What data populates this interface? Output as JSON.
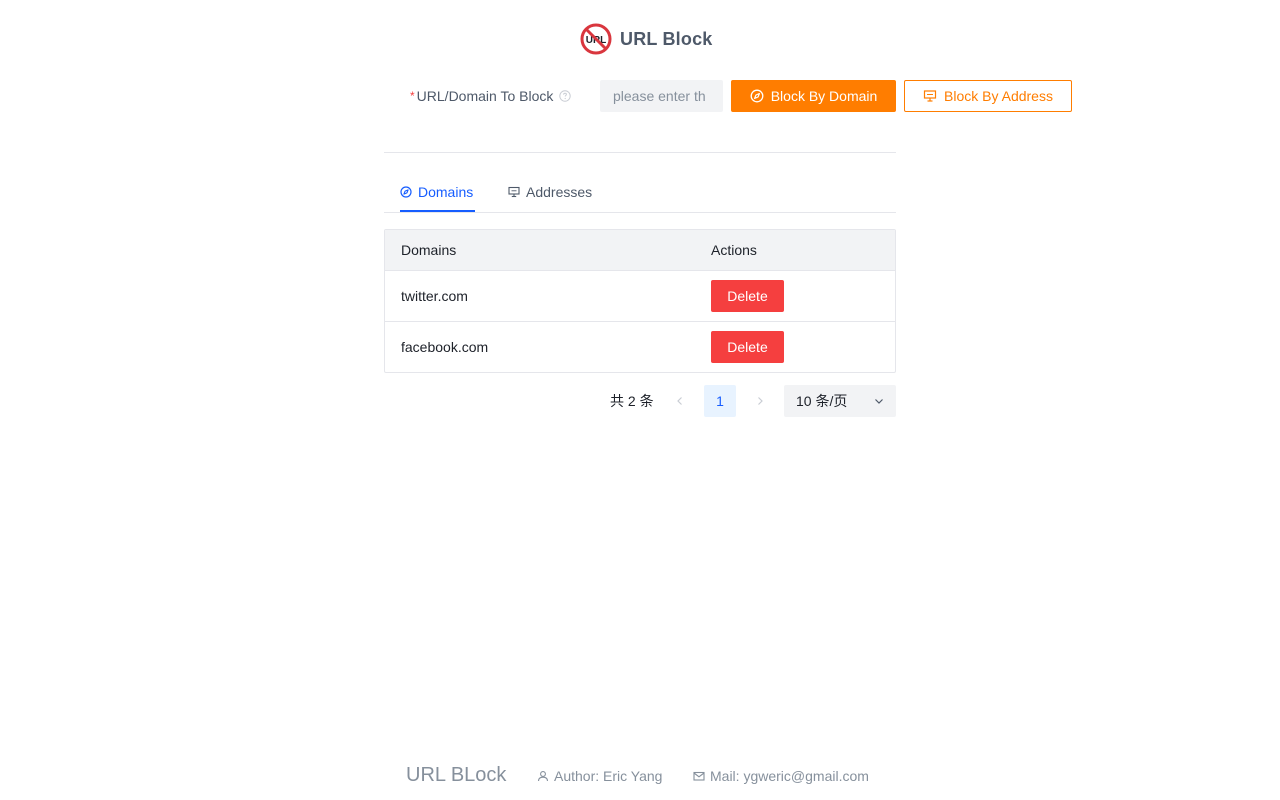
{
  "header": {
    "title": "URL Block",
    "logo_text": "URL"
  },
  "form": {
    "label": "URL/Domain To Block",
    "input_value": "",
    "input_placeholder": "please enter th",
    "block_domain_label": "Block By Domain",
    "block_address_label": "Block By Address"
  },
  "tabs": [
    {
      "label": "Domains",
      "active": true,
      "icon": "compass-icon"
    },
    {
      "label": "Addresses",
      "active": false,
      "icon": "monitor-icon"
    }
  ],
  "table": {
    "columns": [
      "Domains",
      "Actions"
    ],
    "rows": [
      {
        "domain": "twitter.com",
        "action": "Delete"
      },
      {
        "domain": "facebook.com",
        "action": "Delete"
      }
    ]
  },
  "pagination": {
    "total_text": "共 2 条",
    "current_page": "1",
    "page_size": "10 条/页"
  },
  "footer": {
    "brand": "URL BLock",
    "author": "Author: Eric Yang",
    "mail": "Mail: ygweric@gmail.com"
  },
  "colors": {
    "accent": "#ff7d00",
    "primary_blue": "#165dff",
    "danger": "#f53f3f",
    "logo_red": "#d9363e"
  }
}
